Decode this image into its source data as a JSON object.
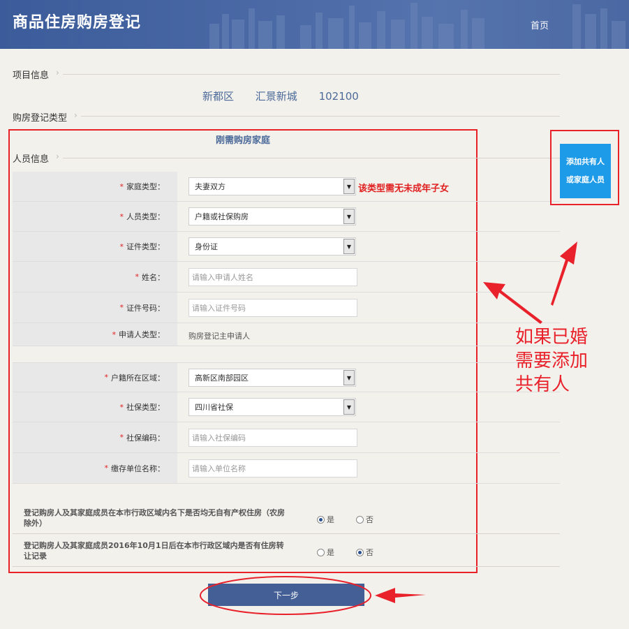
{
  "header": {
    "title": "商品住房购房登记",
    "nav_home": "首页"
  },
  "sections": {
    "project_info": "项目信息",
    "register_type": "购房登记类型",
    "person_info": "人员信息"
  },
  "project": {
    "district": "新都区",
    "name": "汇景新城",
    "code": "102100"
  },
  "family_type_title": "刚需购房家庭",
  "fields": {
    "family_type": {
      "label": "家庭类型：",
      "value": "夫妻双方",
      "hint": "该类型需无未成年子女"
    },
    "person_type": {
      "label": "人员类型：",
      "value": "户籍或社保购房"
    },
    "id_type": {
      "label": "证件类型：",
      "value": "身份证"
    },
    "name": {
      "label": "姓名：",
      "placeholder": "请输入申请人姓名"
    },
    "id_number": {
      "label": "证件号码：",
      "placeholder": "请输入证件号码"
    },
    "applicant_type": {
      "label": "申请人类型：",
      "value": "购房登记主申请人"
    },
    "hukou_region": {
      "label": "户籍所在区域：",
      "value": "高新区南部园区"
    },
    "social_type": {
      "label": "社保类型：",
      "value": "四川省社保"
    },
    "social_code": {
      "label": "社保编码：",
      "placeholder": "请输入社保编码"
    },
    "employer": {
      "label": "缴存单位名称：",
      "placeholder": "请输入单位名称"
    }
  },
  "questions": [
    {
      "text": "登记购房人及其家庭成员在本市行政区域内名下是否均无自有产权住房（农房除外）",
      "yes": "是",
      "no": "否",
      "selected": "yes"
    },
    {
      "text": "登记购房人及其家庭成员2016年10月1日后在本市行政区域内是否有住房转让记录",
      "yes": "是",
      "no": "否",
      "selected": "no"
    }
  ],
  "add_button": {
    "line1": "添加共有人",
    "line2": "或家庭人员"
  },
  "next_button": "下一步",
  "annotation": {
    "line1": "如果已婚",
    "line2": "需要添加",
    "line3": "共有人"
  },
  "colors": {
    "header": "#3b5b9a",
    "annotation": "#e8212b",
    "add_button": "#1e9be8",
    "next_button": "#435f96"
  }
}
